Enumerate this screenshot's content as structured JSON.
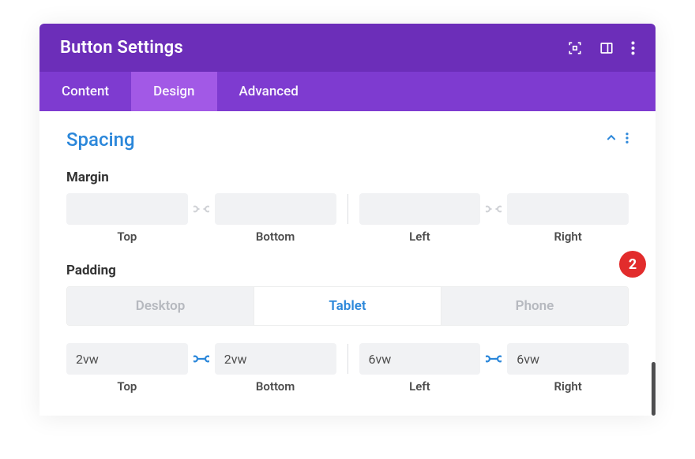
{
  "header": {
    "title": "Button Settings"
  },
  "tabs": {
    "content": "Content",
    "design": "Design",
    "advanced": "Advanced"
  },
  "section": {
    "title": "Spacing"
  },
  "margin": {
    "label": "Margin",
    "top": {
      "value": "",
      "label": "Top"
    },
    "bottom": {
      "value": "",
      "label": "Bottom"
    },
    "left": {
      "value": "",
      "label": "Left"
    },
    "right": {
      "value": "",
      "label": "Right"
    }
  },
  "padding": {
    "label": "Padding",
    "devices": {
      "desktop": "Desktop",
      "tablet": "Tablet",
      "phone": "Phone"
    },
    "top": {
      "value": "2vw",
      "label": "Top"
    },
    "bottom": {
      "value": "2vw",
      "label": "Bottom"
    },
    "left": {
      "value": "6vw",
      "label": "Left"
    },
    "right": {
      "value": "6vw",
      "label": "Right"
    }
  },
  "badge": "2"
}
